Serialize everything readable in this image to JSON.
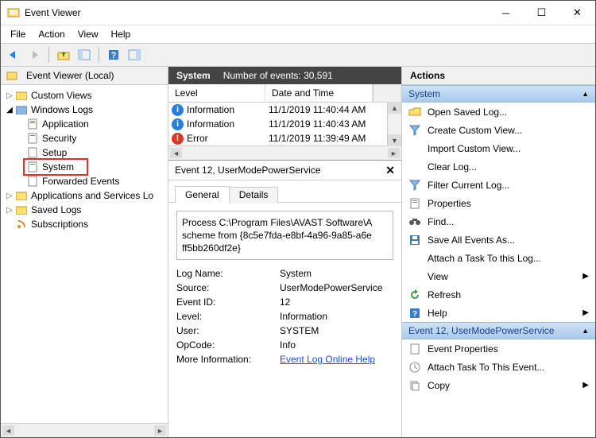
{
  "window": {
    "title": "Event Viewer"
  },
  "menu": {
    "file": "File",
    "action": "Action",
    "view": "View",
    "help": "Help"
  },
  "tree": {
    "root": "Event Viewer (Local)",
    "custom_views": "Custom Views",
    "windows_logs": "Windows Logs",
    "application": "Application",
    "security": "Security",
    "setup": "Setup",
    "system": "System",
    "forwarded": "Forwarded Events",
    "apps_services": "Applications and Services Lo",
    "saved": "Saved Logs",
    "subscriptions": "Subscriptions"
  },
  "center": {
    "title": "System",
    "count_label": "Number of events:",
    "count": "30,591",
    "cols": {
      "level": "Level",
      "dt": "Date and Time"
    },
    "rows": [
      {
        "level": "Information",
        "kind": "info",
        "dt": "11/1/2019 11:40:44 AM"
      },
      {
        "level": "Information",
        "kind": "info",
        "dt": "11/1/2019 11:40:43 AM"
      },
      {
        "level": "Error",
        "kind": "error",
        "dt": "11/1/2019 11:39:49 AM"
      }
    ]
  },
  "detail": {
    "header": "Event 12, UserModePowerService",
    "tabs": {
      "general": "General",
      "details": "Details"
    },
    "message_l1": "Process C:\\Program Files\\AVAST Software\\A",
    "message_l2": "scheme from {8c5e7fda-e8bf-4a96-9a85-a6e",
    "message_l3": "ff5bb260df2e}",
    "log_name_k": "Log Name:",
    "log_name_v": "System",
    "source_k": "Source:",
    "source_v": "UserModePowerService",
    "event_id_k": "Event ID:",
    "event_id_v": "12",
    "level_k": "Level:",
    "level_v": "Information",
    "user_k": "User:",
    "user_v": "SYSTEM",
    "opcode_k": "OpCode:",
    "opcode_v": "Info",
    "more_k": "More Information:",
    "more_v": "Event Log Online Help"
  },
  "actions": {
    "title": "Actions",
    "sec1": "System",
    "open_saved": "Open Saved Log...",
    "create_view": "Create Custom View...",
    "import_view": "Import Custom View...",
    "clear_log": "Clear Log...",
    "filter": "Filter Current Log...",
    "properties": "Properties",
    "find": "Find...",
    "save_all": "Save All Events As...",
    "attach_task": "Attach a Task To this Log...",
    "view": "View",
    "refresh": "Refresh",
    "help": "Help",
    "sec2": "Event 12, UserModePowerService",
    "event_props": "Event Properties",
    "attach_task2": "Attach Task To This Event...",
    "copy": "Copy"
  }
}
